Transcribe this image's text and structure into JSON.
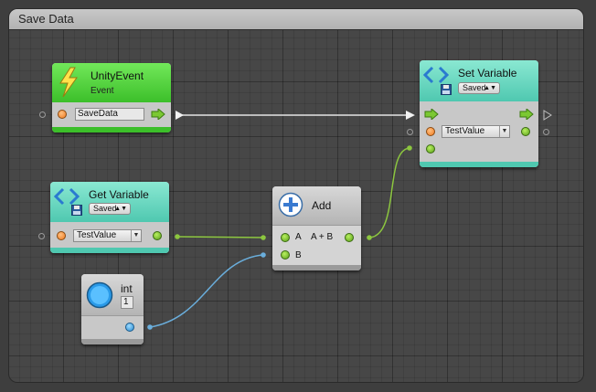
{
  "panel": {
    "title": "Save Data"
  },
  "nodes": {
    "unity_event": {
      "title": "UnityEvent",
      "subtitle": "Event",
      "field": "SaveData"
    },
    "set_variable": {
      "title": "Set Variable",
      "badge": "Saved",
      "field": "TestValue"
    },
    "get_variable": {
      "title": "Get Variable",
      "badge": "Saved",
      "field": "TestValue"
    },
    "add": {
      "title": "Add",
      "input_a": "A",
      "input_b": "B",
      "output": "A + B"
    },
    "int_node": {
      "title": "int",
      "value": "1"
    }
  },
  "colors": {
    "event_header": "#4fce3a",
    "variable_header": "#6fd6bf",
    "green_wire": "#8cc63f",
    "blue_wire": "#6aaedc",
    "exec_wire": "#e6e6e6"
  }
}
